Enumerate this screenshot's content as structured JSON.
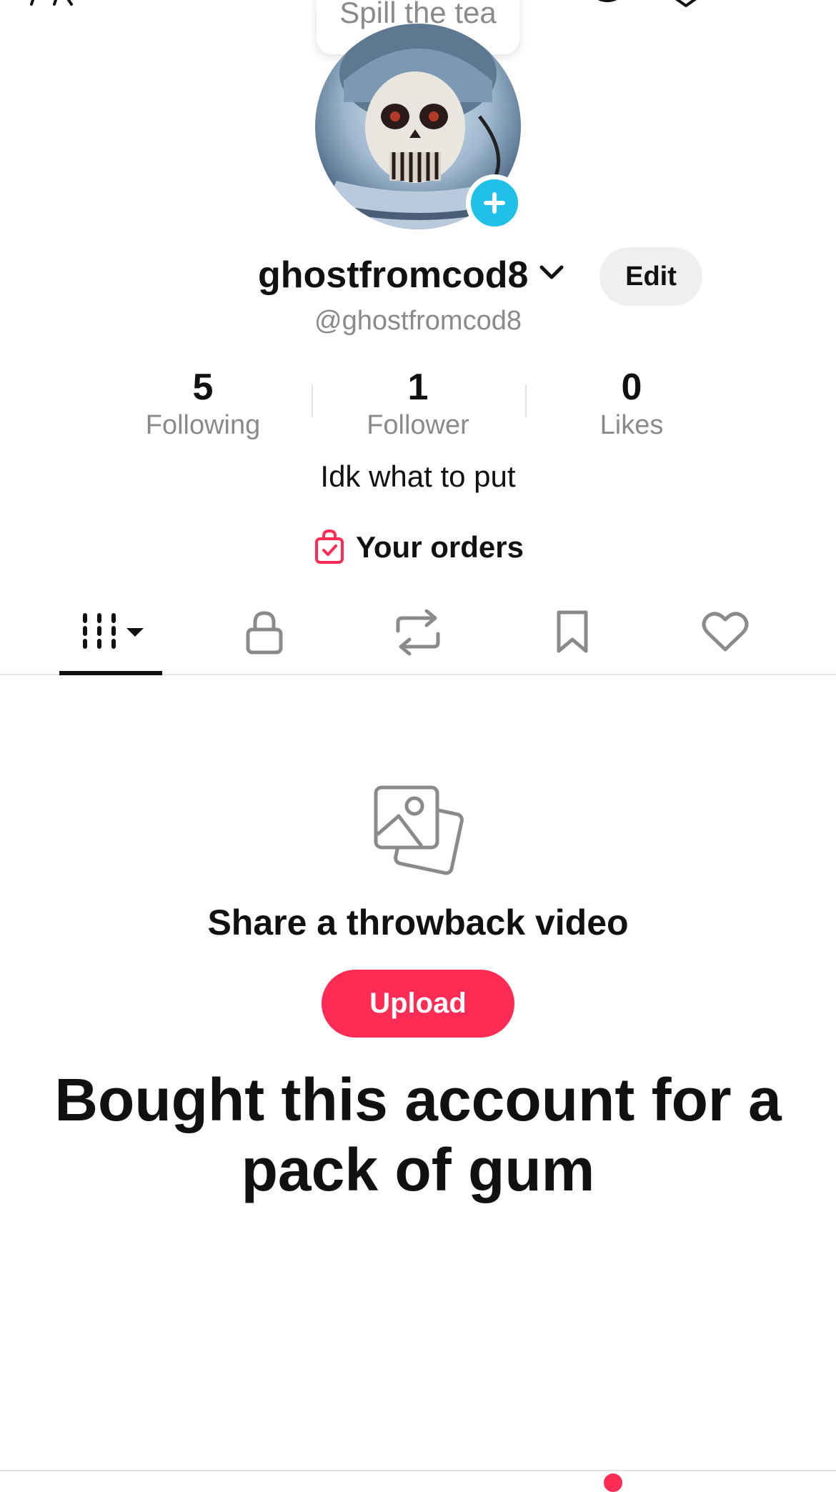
{
  "bubble": {
    "text": "Spill the tea"
  },
  "profile": {
    "username": "ghostfromcod8",
    "handle": "@ghostfromcod8",
    "edit_label": "Edit",
    "bio": "Idk what to put"
  },
  "stats": [
    {
      "value": "5",
      "label": "Following"
    },
    {
      "value": "1",
      "label": "Follower"
    },
    {
      "value": "0",
      "label": "Likes"
    }
  ],
  "orders": {
    "label": "Your orders"
  },
  "tabs": [
    {
      "icon": "grid-videos-icon",
      "active": true
    },
    {
      "icon": "lock-icon",
      "active": false
    },
    {
      "icon": "repost-icon",
      "active": false
    },
    {
      "icon": "bookmark-icon",
      "active": false
    },
    {
      "icon": "heart-icon",
      "active": false
    }
  ],
  "empty_state": {
    "icon": "photos-icon",
    "title": "Share a throwback video",
    "upload_label": "Upload"
  },
  "overlay_caption": "Bought  this account for a pack of gum",
  "colors": {
    "accent": "#fe2c55",
    "badge": "#20c0e8",
    "muted_text": "#8a8a8a"
  }
}
